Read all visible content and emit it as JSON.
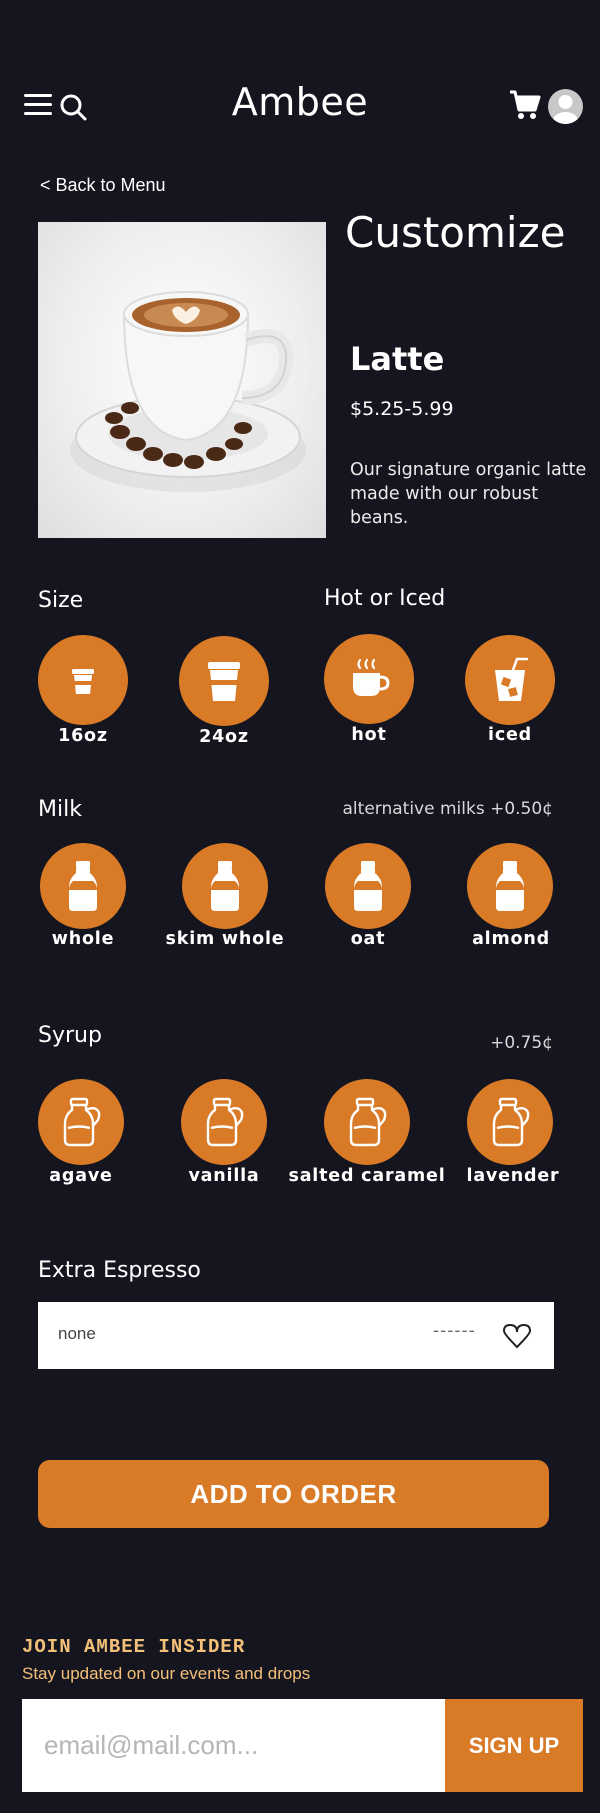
{
  "header": {
    "brand": "Ambee",
    "menu_icon": "hamburger-menu-icon",
    "search_icon": "search-icon",
    "cart_icon": "shopping-cart-icon",
    "avatar_icon": "user-avatar-icon"
  },
  "nav": {
    "back_label": "< Back to Menu"
  },
  "page": {
    "heading": "Customize"
  },
  "product": {
    "name": "Latte",
    "price": "$5.25-5.99",
    "description": "Our signature organic latte made with our robust beans.",
    "image": "latte-cup-photo"
  },
  "size": {
    "title": "Size",
    "options": [
      {
        "label": "16oz",
        "icon": "small-cup-icon"
      },
      {
        "label": "24oz",
        "icon": "large-cup-icon"
      }
    ]
  },
  "temperature": {
    "title": "Hot or Iced",
    "options": [
      {
        "label": "hot",
        "icon": "hot-cup-icon"
      },
      {
        "label": "iced",
        "icon": "iced-cup-icon"
      }
    ]
  },
  "milk": {
    "title": "Milk",
    "note": "alternative milks +0.50¢",
    "options": [
      {
        "label": "whole",
        "icon": "milk-bottle-icon"
      },
      {
        "label": "skim whole",
        "icon": "milk-bottle-icon"
      },
      {
        "label": "oat",
        "icon": "milk-bottle-icon"
      },
      {
        "label": "almond",
        "icon": "milk-bottle-icon"
      }
    ]
  },
  "syrup": {
    "title": "Syrup",
    "note": "+0.75¢",
    "options": [
      {
        "label": "agave",
        "icon": "syrup-jar-icon"
      },
      {
        "label": "vanilla",
        "icon": "syrup-jar-icon"
      },
      {
        "label": "salted caramel",
        "icon": "syrup-jar-icon"
      },
      {
        "label": "lavender",
        "icon": "syrup-jar-icon"
      }
    ]
  },
  "espresso": {
    "title": "Extra Espresso",
    "value": "none",
    "dashes": "------"
  },
  "cta": {
    "add_to_order": "ADD TO ORDER"
  },
  "newsletter": {
    "title": "JOIN AMBEE INSIDER",
    "subtitle": "Stay updated on our events and drops",
    "placeholder": "email@mail.com...",
    "button": "SIGN UP"
  },
  "colors": {
    "background": "#15151f",
    "accent": "#d97a27",
    "newsletter_text": "#f3c07a"
  }
}
